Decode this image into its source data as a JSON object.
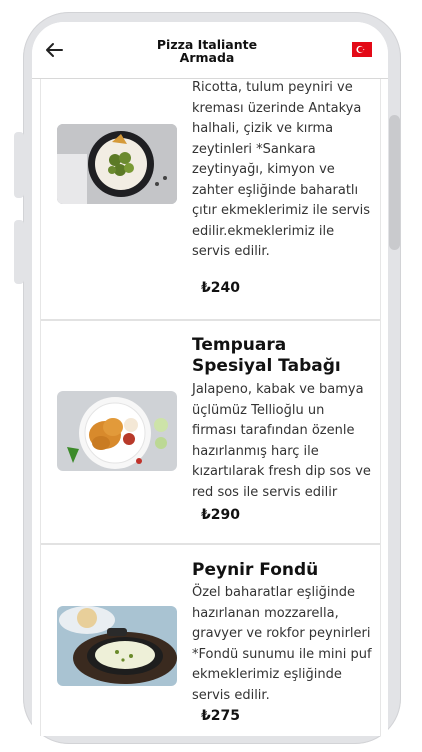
{
  "header": {
    "title": "Pizza Italiante Armada",
    "back_icon": "arrow-left-icon",
    "flag_icon": "turkey-flag-icon"
  },
  "items": [
    {
      "name": "",
      "description": "Ricotta, tulum peyniri ve kreması üzerinde Antakya halhali, çizik ve kırma zeytinleri *Sankara zeytinyağı, kimyon ve zahter eşliğinde baharatlı çıtır ekmeklerimiz ile servis edilir.ekmeklerimiz ile servis edilir.",
      "price": "₺240"
    },
    {
      "name": "Tempuara Spesiyal Tabağı",
      "description": "Jalapeno, kabak ve bamya üçlümüz Tellioğlu un firması tarafından özenle hazırlanmış harç ile kızartılarak fresh dip sos ve red sos ile servis edilir",
      "price": "₺290"
    },
    {
      "name": "Peynir Fondü",
      "description": "Özel baharatlar eşliğinde hazırlanan mozzarella, gravyer ve rokfor peynirleri *Fondü sunumu ile mini puf ekmeklerimiz eşliğinde servis edilir.",
      "price": "₺275"
    }
  ],
  "colors": {
    "flag_red": "#e30a17",
    "frame": "#e2e3e6"
  }
}
